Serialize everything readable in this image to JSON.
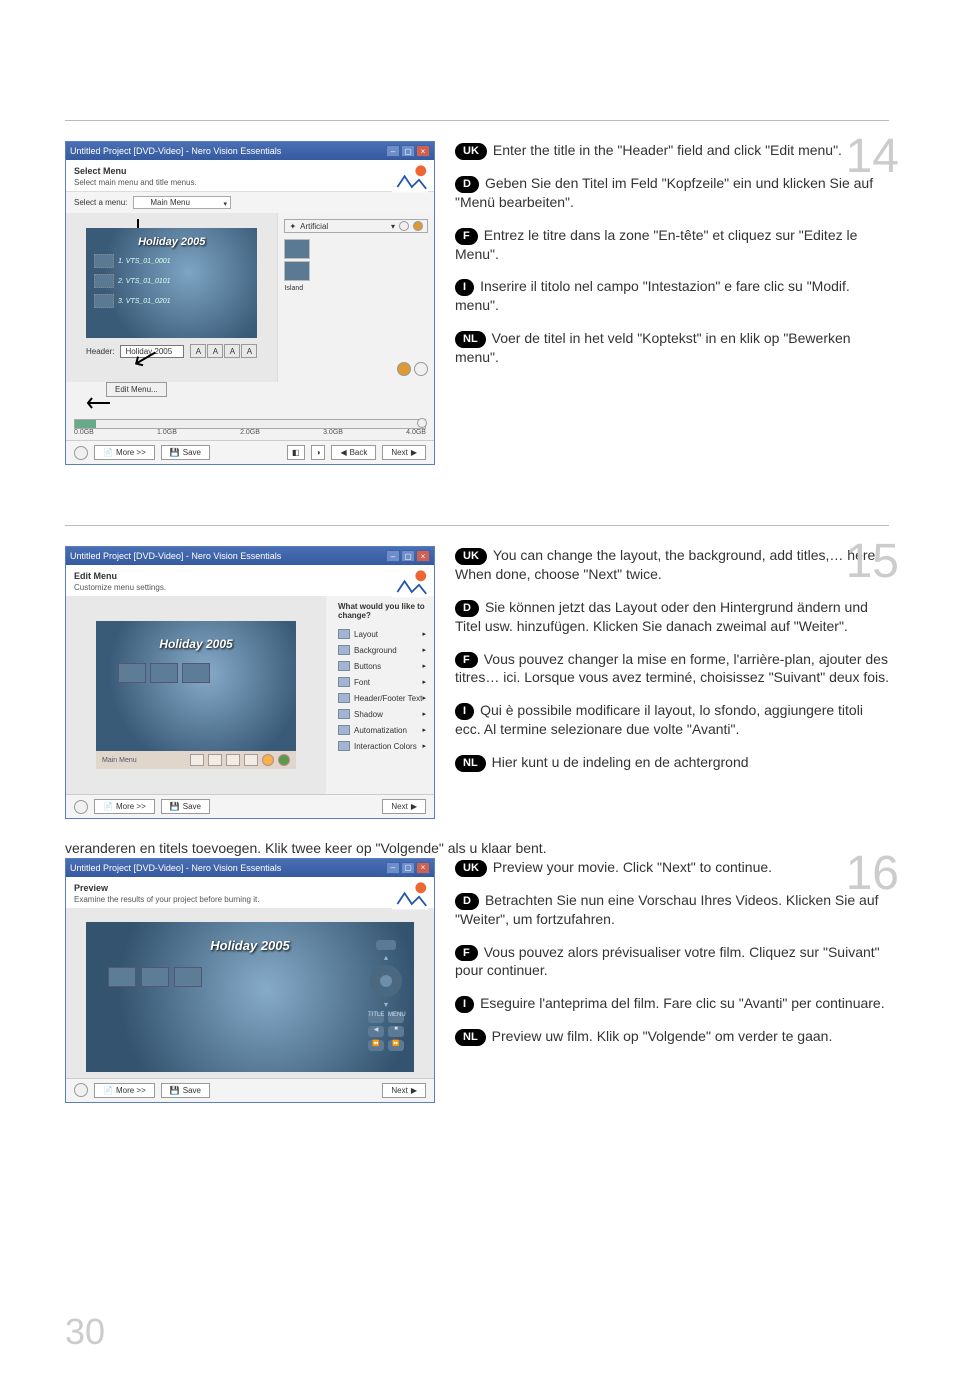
{
  "page_number": "30",
  "steps": {
    "14": {
      "num": "14",
      "uk": "Enter the title in the \"Header\" field and click \"Edit menu\".",
      "d": "Geben Sie den Titel im Feld \"Kopfzeile\" ein und klicken Sie auf \"Menü bearbeiten\".",
      "f": "Entrez le titre dans la zone \"En-tête\" et cliquez sur \"Editez le Menu\".",
      "i": "Inserire il titolo nel campo \"Intestazion\" e fare clic su \"Modif. menu\".",
      "nl": "Voer de titel in het veld \"Koptekst\" in en klik op \"Bewerken menu\"."
    },
    "15": {
      "num": "15",
      "uk": "You can change the layout, the background, add titles,… here. When done, choose \"Next\" twice.",
      "d": "Sie können jetzt das Layout oder den Hintergrund ändern und Titel usw. hinzufügen. Klicken Sie danach zweimal auf \"Weiter\".",
      "f": "Vous pouvez changer la mise en forme, l'arrière-plan, ajouter des titres… ici. Lorsque vous avez terminé, choisissez \"Suivant\" deux fois.",
      "i": "Qui è possibile modificare il layout, lo sfondo, aggiungere titoli ecc. Al termine selezionare due volte \"Avanti\".",
      "nl_prefix": "Hier kunt u de indeling en de achtergrond",
      "nl_wrap": "veranderen en titels toevoegen. Klik twee keer op \"Volgende\" als u klaar bent."
    },
    "16": {
      "num": "16",
      "uk": "Preview your movie. Click \"Next\" to continue.",
      "d": "Betrachten Sie nun eine Vorschau Ihres Videos. Klicken Sie auf \"Weiter\", um fortzufahren.",
      "f": "Vous pouvez alors prévisualiser votre film. Cliquez sur \"Suivant\" pour continuer.",
      "i": "Eseguire l'anteprima del film. Fare clic su \"Avanti\" per continuare.",
      "nl": "Preview uw film. Klik op \"Volgende\" om verder te gaan."
    }
  },
  "badges": {
    "uk": "UK",
    "d": "D",
    "f": "F",
    "i": "I",
    "nl": "NL"
  },
  "win": {
    "title": "Untitled Project [DVD-Video] - Nero Vision Essentials",
    "select_menu_title": "Select Menu",
    "select_menu_sub": "Select main menu and title menus.",
    "select_a_menu": "Select a menu:",
    "main_menu": "Main Menu",
    "holiday": "Holiday 2005",
    "chap1": "1. VTS_01_0001",
    "chap2": "2. VTS_01_0101",
    "chap3": "3. VTS_01_0201",
    "header_label": "Header:",
    "header_value": "Holiday 2005",
    "edit_menu": "Edit Menu...",
    "artificial": "Artificial",
    "island": "Island",
    "capacity": [
      "0.0GB",
      "1.0GB",
      "2.0GB",
      "3.0GB",
      "4.0GB"
    ],
    "more": "More >>",
    "save": "Save",
    "back": "Back",
    "next": "Next",
    "edit_menu_title": "Edit Menu",
    "edit_menu_sub": "Customize menu settings.",
    "change_title": "What would you like to change?",
    "change_items": [
      "Layout",
      "Background",
      "Buttons",
      "Font",
      "Header/Footer Text",
      "Shadow",
      "Automatization",
      "Interaction Colors"
    ],
    "preview_title": "Preview",
    "preview_sub": "Examine the results of your project before burning it.",
    "remote_menu": "Menu",
    "remote_title": "TITLE",
    "remote_subm": "MENU"
  }
}
